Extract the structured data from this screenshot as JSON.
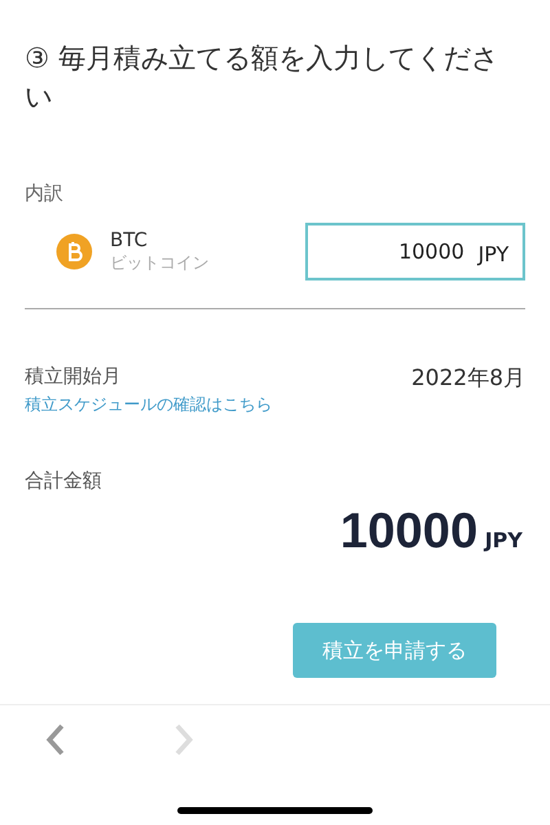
{
  "title": "③ 毎月積み立てる額を入力してください",
  "breakdown": {
    "label": "内訳",
    "items": [
      {
        "symbol": "BTC",
        "name": "ビットコイン",
        "amount": "10000",
        "unit": "JPY"
      }
    ]
  },
  "start": {
    "label": "積立開始月",
    "value": "2022年8月",
    "link": "積立スケジュールの確認はこちら"
  },
  "total": {
    "label": "合計金額",
    "amount": "10000",
    "unit": "JPY"
  },
  "submit": {
    "label": "積立を申請する"
  },
  "nav": [
    {
      "kind": "back",
      "disabled": false
    },
    {
      "kind": "forward",
      "disabled": true
    }
  ]
}
